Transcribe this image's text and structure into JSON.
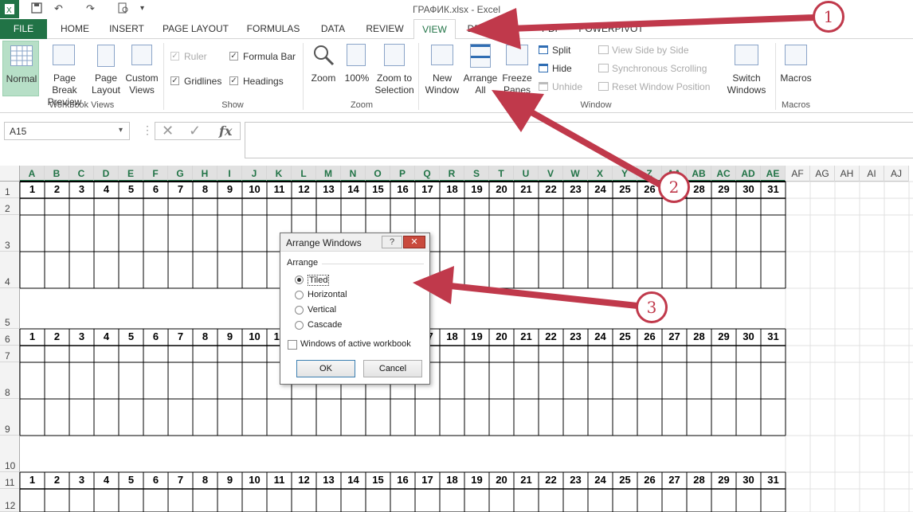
{
  "app": {
    "title": "ГРАФИК.xlsx - Excel"
  },
  "tabs": [
    {
      "label": "FILE"
    },
    {
      "label": "HOME"
    },
    {
      "label": "INSERT"
    },
    {
      "label": "PAGE LAYOUT"
    },
    {
      "label": "FORMULAS"
    },
    {
      "label": "DATA"
    },
    {
      "label": "REVIEW"
    },
    {
      "label": "VIEW"
    },
    {
      "label": "DE"
    },
    {
      "label": "PDF"
    },
    {
      "label": "POWERPIVOT"
    }
  ],
  "ribbon": {
    "workbook_views": {
      "label": "Workbook Views",
      "normal": "Normal",
      "page_break": "Page Break Preview",
      "page_layout": "Page Layout",
      "custom_views": "Custom Views"
    },
    "show": {
      "label": "Show",
      "ruler": "Ruler",
      "formula_bar": "Formula Bar",
      "gridlines": "Gridlines",
      "headings": "Headings"
    },
    "zoom": {
      "label": "Zoom",
      "zoom": "Zoom",
      "hundred": "100%",
      "zoom_selection": "Zoom to Selection"
    },
    "window": {
      "label": "Window",
      "new_window": "New Window",
      "arrange_all": "Arrange All",
      "freeze_panes": "Freeze Panes",
      "split": "Split",
      "hide": "Hide",
      "unhide": "Unhide",
      "side_by_side": "View Side by Side",
      "sync_scroll": "Synchronous Scrolling",
      "reset_pos": "Reset Window Position",
      "switch_windows": "Switch Windows"
    },
    "macros": {
      "label": "Macros",
      "macros": "Macros"
    }
  },
  "formula_bar": {
    "name_box": "A15",
    "fx": "fx",
    "value": ""
  },
  "grid": {
    "columns": [
      "A",
      "B",
      "C",
      "D",
      "E",
      "F",
      "G",
      "H",
      "I",
      "J",
      "K",
      "L",
      "M",
      "N",
      "O",
      "P",
      "Q",
      "R",
      "S",
      "T",
      "U",
      "V",
      "W",
      "X",
      "Y",
      "Z",
      "AA",
      "AB",
      "AC",
      "AD",
      "AE",
      "AF",
      "AG",
      "AH",
      "AI",
      "AJ"
    ],
    "rows": [
      "1",
      "2",
      "3",
      "4",
      "5",
      "6",
      "7",
      "8",
      "9",
      "10",
      "11",
      "12"
    ],
    "day_numbers": [
      "1",
      "2",
      "3",
      "4",
      "5",
      "6",
      "7",
      "8",
      "9",
      "10",
      "11",
      "12",
      "13",
      "14",
      "15",
      "16",
      "17",
      "18",
      "19",
      "20",
      "21",
      "22",
      "23",
      "24",
      "25",
      "26",
      "27",
      "28",
      "29",
      "30",
      "31"
    ]
  },
  "dialog": {
    "title": "Arrange Windows",
    "help": "?",
    "section": "Arrange",
    "options": [
      {
        "label": "Tiled",
        "selected": true
      },
      {
        "label": "Horizontal",
        "selected": false
      },
      {
        "label": "Vertical",
        "selected": false
      },
      {
        "label": "Cascade",
        "selected": false
      }
    ],
    "checkbox": "Windows of active workbook",
    "ok": "OK",
    "cancel": "Cancel"
  },
  "annotations": [
    {
      "label": "1"
    },
    {
      "label": "2"
    },
    {
      "label": "3"
    }
  ],
  "colors": {
    "excel_green": "#217346",
    "arrow": "#c0394b"
  }
}
